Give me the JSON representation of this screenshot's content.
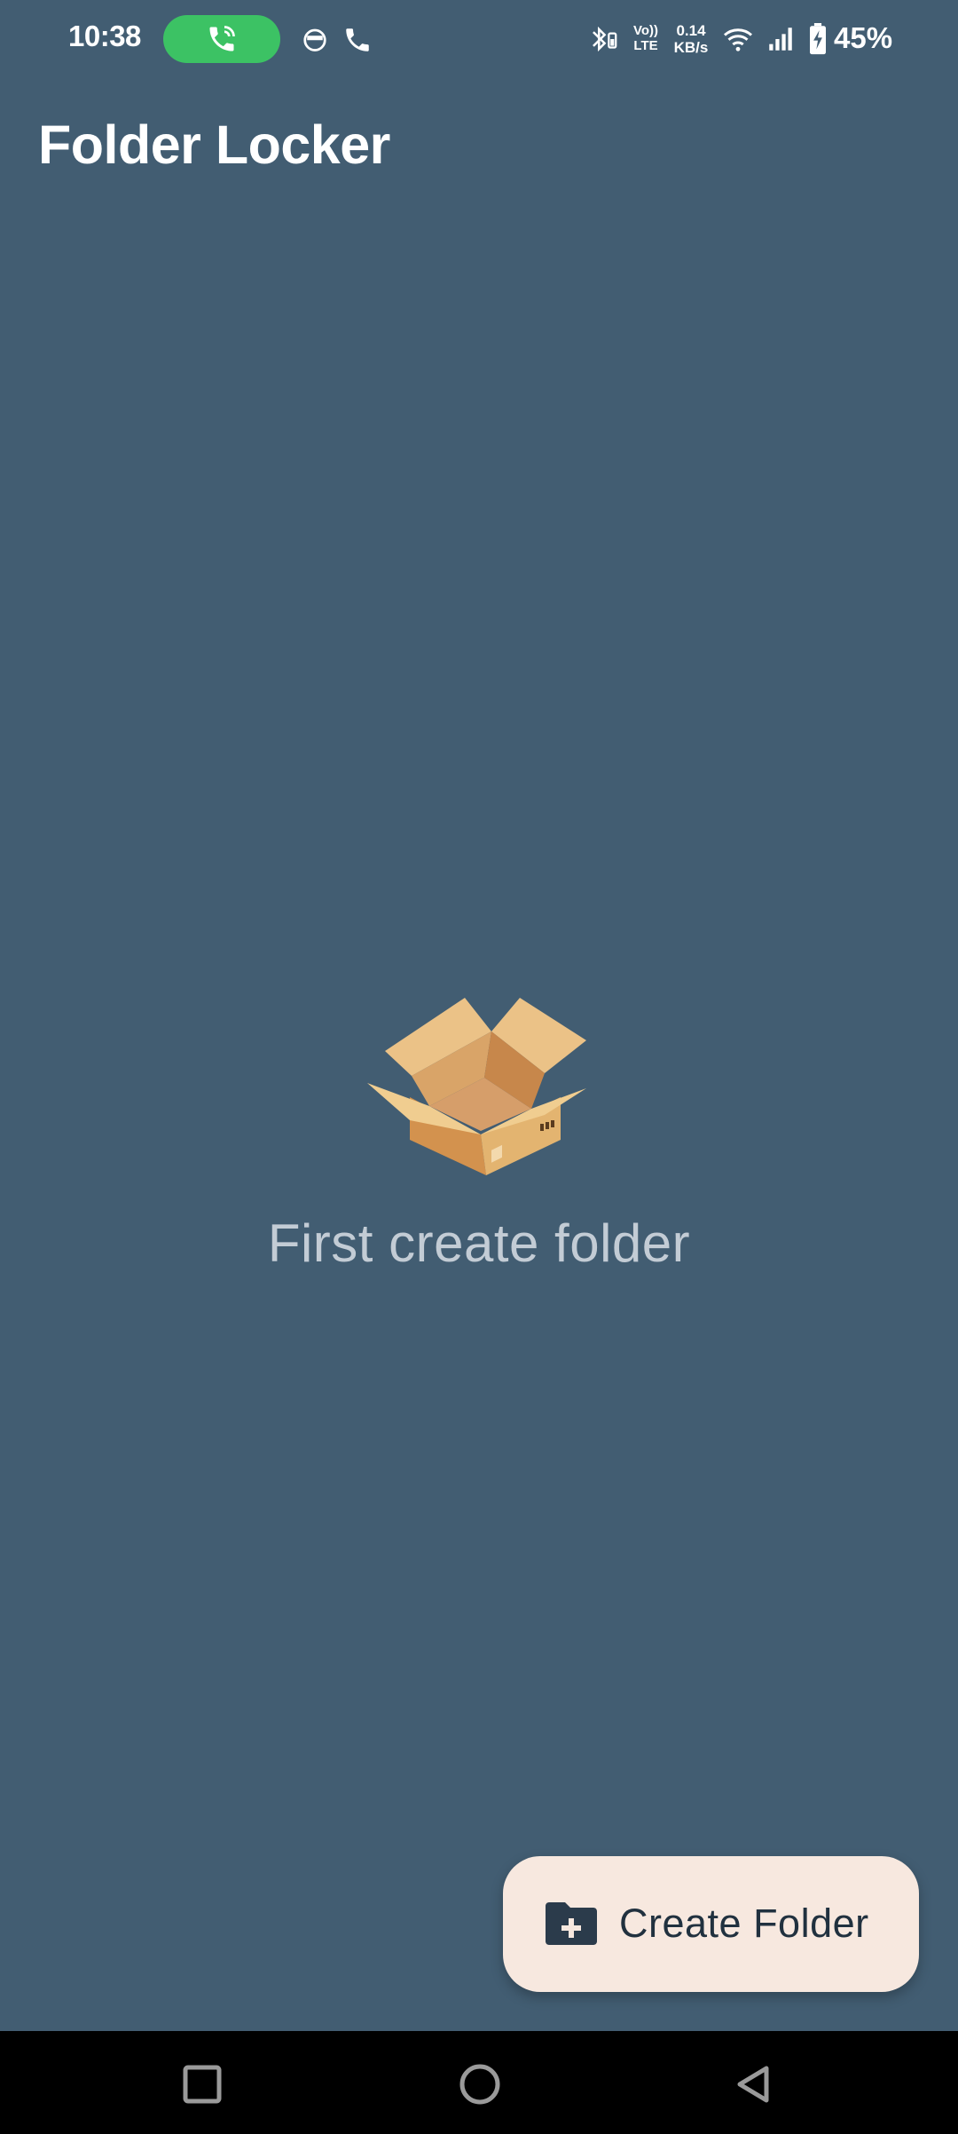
{
  "status_bar": {
    "time": "10:38",
    "net_speed_value": "0.14",
    "net_speed_unit": "KB/s",
    "volte_label_top": "Vo))",
    "volte_label_bottom": "LTE",
    "battery_percent": "45%",
    "icons": [
      "phone-call-icon",
      "android-face-icon",
      "phone-icon",
      "bluetooth-battery-icon",
      "volte-icon",
      "wifi-icon",
      "signal-icon",
      "battery-charging-icon"
    ],
    "call_pill_color": "#3cc264"
  },
  "app_bar": {
    "title": "Folder Locker"
  },
  "empty_state": {
    "illustration": "open-box-icon",
    "message": "First create folder"
  },
  "fab": {
    "label": "Create Folder",
    "icon": "folder-add-icon",
    "background": "#f7e8df"
  },
  "nav_bar": {
    "buttons": [
      "recents-button",
      "home-button",
      "back-button"
    ]
  },
  "colors": {
    "background": "#425d72",
    "message_text": "#c3ccd5",
    "fab_text": "#21313f"
  }
}
